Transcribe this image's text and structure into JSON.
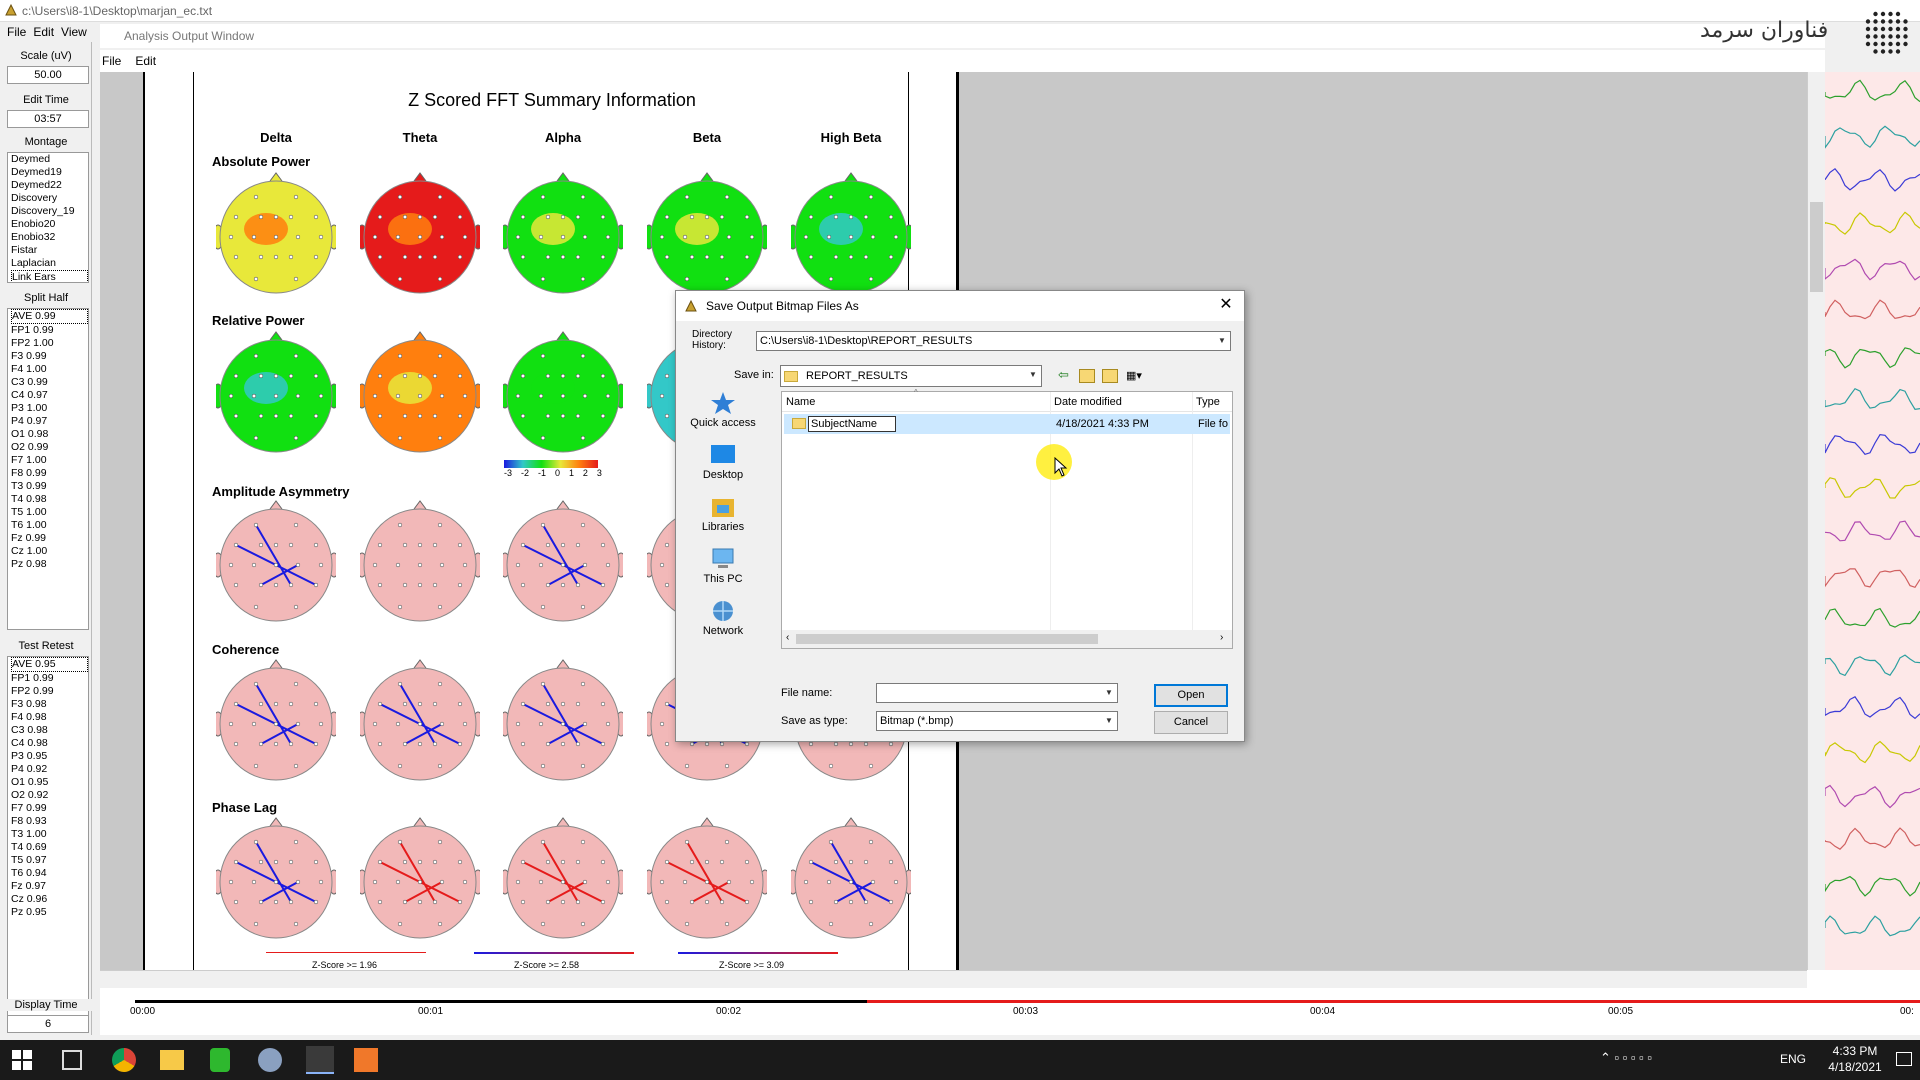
{
  "app": {
    "title": "c:\\Users\\i8-1\\Desktop\\marjan_ec.txt",
    "menu": [
      "File",
      "Edit",
      "View"
    ],
    "watermark": "فناوران سرمد"
  },
  "left_panel": {
    "scale_label": "Scale (uV)",
    "scale_value": "50.00",
    "edit_time_label": "Edit Time",
    "edit_time_value": "03:57",
    "montage_label": "Montage",
    "montage_items": [
      "Deymed",
      "Deymed19",
      "Deymed22",
      "Discovery",
      "Discovery_19",
      "Enobio20",
      "Enobio32",
      "Fistar",
      "Laplacian",
      "Link Ears"
    ],
    "split_half_label": "Split Half",
    "split_half_items": [
      "AVE  0.99",
      "FP1  0.99",
      "FP2  1.00",
      "F3  0.99",
      "F4  1.00",
      "C3  0.99",
      "C4  0.97",
      "P3  1.00",
      "P4  0.97",
      "O1  0.98",
      "O2  0.99",
      "F7  1.00",
      "F8  0.99",
      "T3  0.99",
      "T4  0.98",
      "T5  1.00",
      "T6  1.00",
      "Fz  0.99",
      "Cz  1.00",
      "Pz  0.98"
    ],
    "test_retest_label": "Test Retest",
    "test_retest_items": [
      "AVE  0.95",
      "FP1  0.99",
      "FP2  0.99",
      "F3  0.98",
      "F4  0.98",
      "C3  0.98",
      "C4  0.98",
      "P3  0.95",
      "P4  0.92",
      "O1  0.95",
      "O2  0.92",
      "F7  0.99",
      "F8  0.93",
      "T3  1.00",
      "T4  0.69",
      "T5  0.97",
      "T6  0.94",
      "Fz  0.97",
      "Cz  0.96",
      "Pz  0.95"
    ],
    "display_time_label": "Display Time",
    "display_time_value": "6"
  },
  "analysis_window": {
    "title": "Analysis Output Window",
    "menu": [
      "File",
      "Edit"
    ]
  },
  "report": {
    "title": "Z Scored FFT Summary Information",
    "bands": [
      "Delta",
      "Theta",
      "Alpha",
      "Beta",
      "High Beta"
    ],
    "sections": [
      "Absolute Power",
      "Relative Power",
      "Amplitude Asymmetry",
      "Coherence",
      "Phase Lag"
    ],
    "colorbar_ticks": [
      "-3",
      "-2",
      "-1",
      "0",
      "1",
      "2",
      "3"
    ],
    "z_labels": [
      "Z-Score >= 1.96",
      "Z-Score >= 2.58",
      "Z-Score >= 3.09"
    ],
    "colors": {
      "red": "#e51b1b",
      "orange": "#ff7f0e",
      "yellow": "#e8e83a",
      "green": "#11e011",
      "cyan": "#33c8c8",
      "pink": "#f2b8b8",
      "blue": "#1a1ae0"
    }
  },
  "timeline": {
    "ticks": [
      "00:00",
      "00:01",
      "00:02",
      "00:03",
      "00:04",
      "00:05",
      "00:"
    ]
  },
  "dialog": {
    "title": "Save Output Bitmap Files As",
    "directory_history_label": "Directory History:",
    "directory_history_value": "C:\\Users\\i8-1\\Desktop\\REPORT_RESULTS",
    "save_in_label": "Save in:",
    "save_in_value": "REPORT_RESULTS",
    "places": [
      "Quick access",
      "Desktop",
      "Libraries",
      "This PC",
      "Network"
    ],
    "columns": [
      "Name",
      "Date modified",
      "Type"
    ],
    "rows": [
      {
        "name": "SubjectName",
        "date": "4/18/2021 4:33 PM",
        "type": "File fo"
      }
    ],
    "file_name_label": "File name:",
    "file_name_value": "",
    "save_as_type_label": "Save as type:",
    "save_as_type_value": "Bitmap (*.bmp)",
    "open_label": "Open",
    "cancel_label": "Cancel"
  },
  "taskbar": {
    "lang": "ENG",
    "time": "4:33 PM",
    "date": "4/18/2021"
  }
}
